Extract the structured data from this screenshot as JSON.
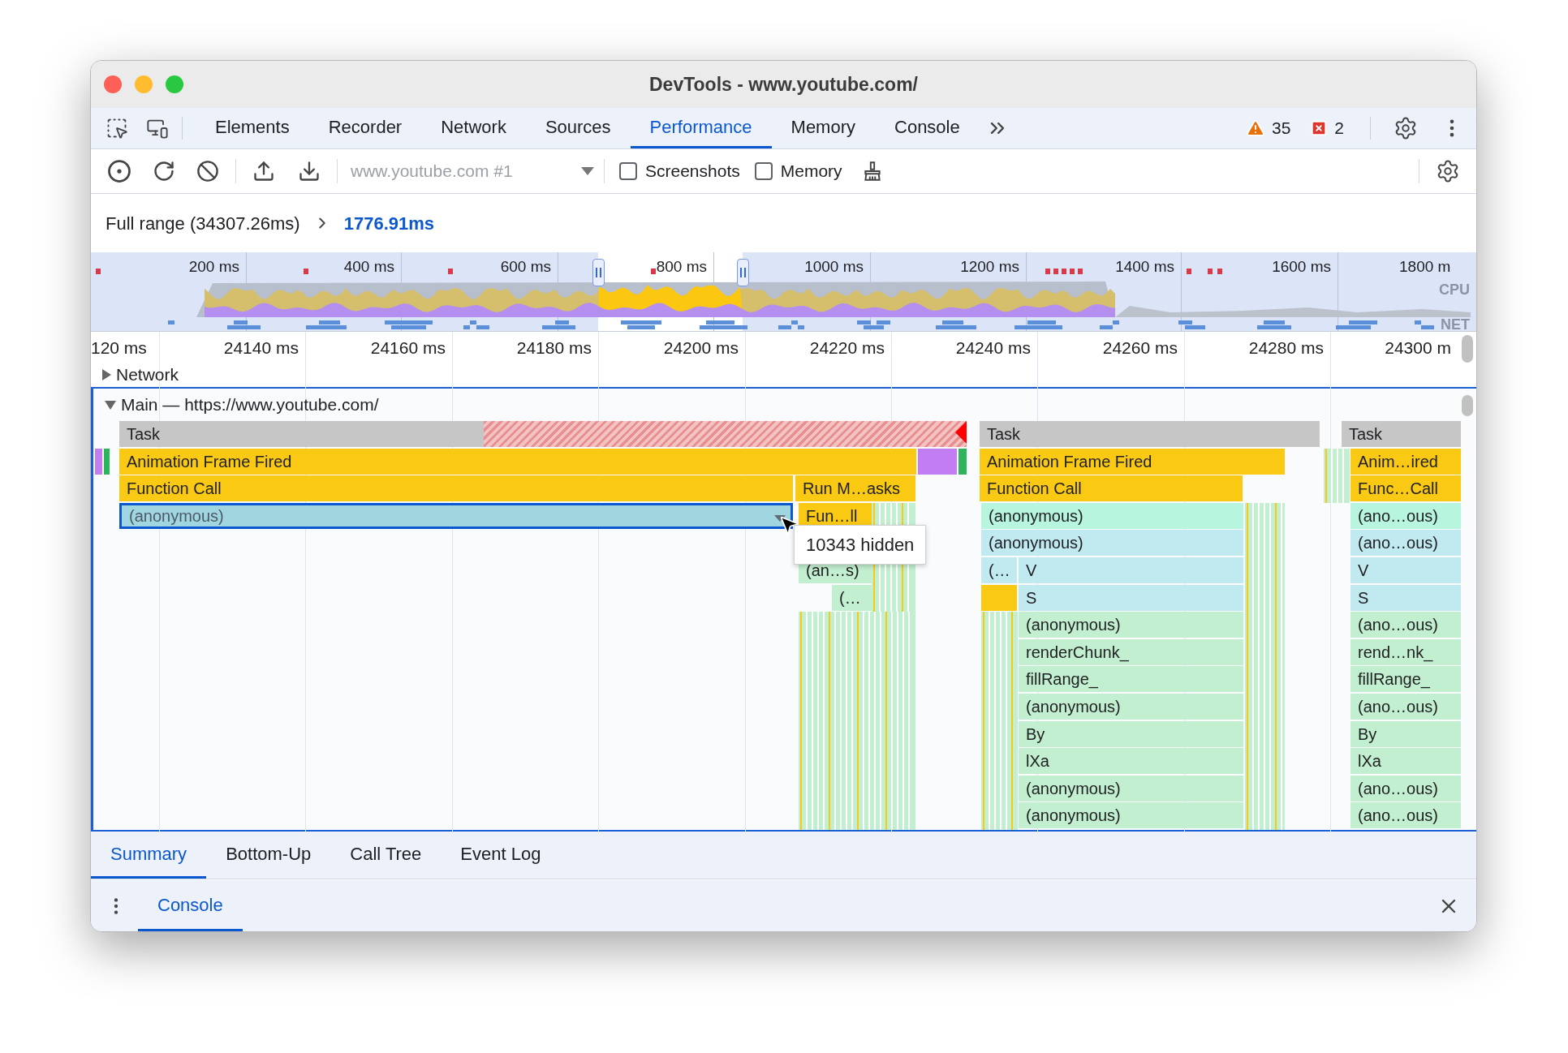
{
  "window": {
    "title": "DevTools - www.youtube.com/"
  },
  "tabs": [
    {
      "label": "Elements",
      "selected": false
    },
    {
      "label": "Recorder",
      "selected": false
    },
    {
      "label": "Network",
      "selected": false
    },
    {
      "label": "Sources",
      "selected": false
    },
    {
      "label": "Performance",
      "selected": true
    },
    {
      "label": "Memory",
      "selected": false
    },
    {
      "label": "Console",
      "selected": false
    }
  ],
  "issues": {
    "warnings": "35",
    "errors": "2"
  },
  "toolbar": {
    "target": {
      "value": "www.youtube.com #1",
      "disabled": true
    },
    "checkboxes": [
      {
        "label": "Screenshots",
        "checked": false
      },
      {
        "label": "Memory",
        "checked": false
      }
    ]
  },
  "breadcrumb": [
    {
      "label": "Full range (34307.26ms)",
      "selected": false
    },
    {
      "label": "1776.91ms",
      "selected": true
    }
  ],
  "overview": {
    "time_labels": [
      "200 ms",
      "400 ms",
      "600 ms",
      "800 ms",
      "1000 ms",
      "1200 ms",
      "1400 ms",
      "1600 ms",
      "1800 m"
    ],
    "track_labels": [
      "CPU",
      "NET"
    ]
  },
  "ruler": {
    "labels": [
      "120 ms",
      "24140 ms",
      "24160 ms",
      "24180 ms",
      "24200 ms",
      "24220 ms",
      "24240 ms",
      "24260 ms",
      "24280 ms",
      "24300 m"
    ]
  },
  "tracks": [
    {
      "name": "Network",
      "expanded": false
    },
    {
      "name": "Main — https://www.youtube.com/",
      "expanded": true
    }
  ],
  "flame_chart": {
    "tooltip": "10343 hidden",
    "entries": [
      {
        "label": "Task",
        "color": "#c6c6c6",
        "selected": false,
        "long_task": true
      },
      {
        "label": "Task",
        "color": "#c6c6c6",
        "selected": false,
        "long_task": false
      },
      {
        "label": "Task",
        "color": "#c6c6c6",
        "selected": false,
        "long_task": false
      },
      {
        "label": "Animation Frame Fired",
        "color": "#fac914",
        "selected": false
      },
      {
        "label": "Animation Frame Fired",
        "color": "#fac914",
        "selected": false
      },
      {
        "label": "Anim…ired",
        "color": "#fac914",
        "selected": false
      },
      {
        "label": "Function Call",
        "color": "#fac914",
        "selected": false
      },
      {
        "label": "Run M…asks",
        "color": "#fac914",
        "selected": false
      },
      {
        "label": "Function Call",
        "color": "#fac914",
        "selected": false
      },
      {
        "label": "Func…Call",
        "color": "#fac914",
        "selected": false
      },
      {
        "label": "(anonymous)",
        "color": "#9fd6df",
        "selected": true
      },
      {
        "label": "Fun…ll",
        "color": "#fac914",
        "selected": false
      },
      {
        "label": "(anonymous)",
        "color": "#b7f5de",
        "selected": false
      },
      {
        "label": "(ano…ous)",
        "color": "#b7f5de",
        "selected": false
      },
      {
        "label": "(anonymous)",
        "color": "#c0eaf0",
        "selected": false
      },
      {
        "label": "(ano…ous)",
        "color": "#c0eaf0",
        "selected": false
      },
      {
        "label": "(an…s)",
        "color": "#c2efcf",
        "selected": false
      },
      {
        "label": "(…",
        "color": "#c0eaf0",
        "selected": false
      },
      {
        "label": "V",
        "color": "#c0eaf0",
        "selected": false
      },
      {
        "label": "V",
        "color": "#c0eaf0",
        "selected": false
      },
      {
        "label": "(…",
        "color": "#c2efcf",
        "selected": false
      },
      {
        "label": "S",
        "color": "#c0eaf0",
        "selected": false
      },
      {
        "label": "S",
        "color": "#c0eaf0",
        "selected": false
      },
      {
        "label": "(anonymous)",
        "color": "#c2efcf",
        "selected": false
      },
      {
        "label": "(ano…ous)",
        "color": "#c2efcf",
        "selected": false
      },
      {
        "label": "renderChunk_",
        "color": "#c2efcf",
        "selected": false
      },
      {
        "label": "rend…nk_",
        "color": "#c2efcf",
        "selected": false
      },
      {
        "label": "fillRange_",
        "color": "#c2efcf",
        "selected": false
      },
      {
        "label": "fillRange_",
        "color": "#c2efcf",
        "selected": false
      },
      {
        "label": "(anonymous)",
        "color": "#c2efcf",
        "selected": false
      },
      {
        "label": "(ano…ous)",
        "color": "#c2efcf",
        "selected": false
      },
      {
        "label": "By",
        "color": "#c2efcf",
        "selected": false
      },
      {
        "label": "By",
        "color": "#c2efcf",
        "selected": false
      },
      {
        "label": "lXa",
        "color": "#c2efcf",
        "selected": false
      },
      {
        "label": "lXa",
        "color": "#c2efcf",
        "selected": false
      },
      {
        "label": "(anonymous)",
        "color": "#c2efcf",
        "selected": false
      },
      {
        "label": "(ano…ous)",
        "color": "#c2efcf",
        "selected": false
      },
      {
        "label": "(anonymous)",
        "color": "#c2efcf",
        "selected": false
      },
      {
        "label": "(ano…ous)",
        "color": "#c2efcf",
        "selected": false
      }
    ]
  },
  "bottom_tabs": [
    {
      "label": "Summary",
      "selected": true
    },
    {
      "label": "Bottom-Up",
      "selected": false
    },
    {
      "label": "Call Tree",
      "selected": false
    },
    {
      "label": "Event Log",
      "selected": false
    }
  ],
  "drawer": {
    "tabs": [
      {
        "label": "Console",
        "selected": true
      }
    ]
  }
}
